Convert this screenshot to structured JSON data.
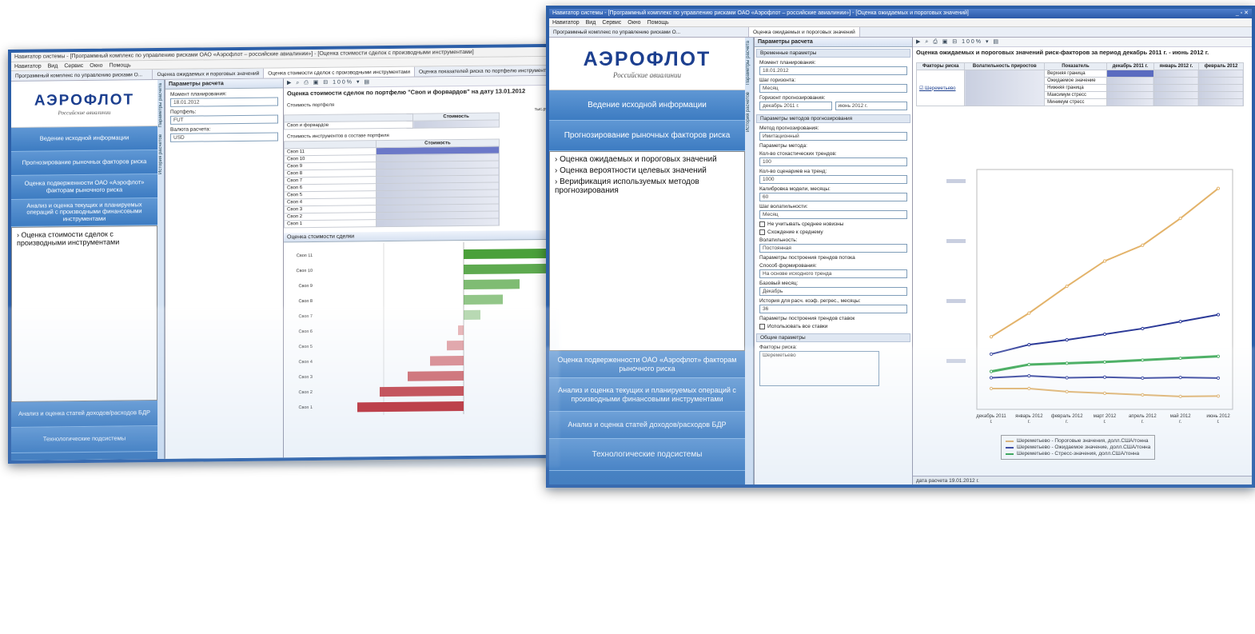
{
  "brand": {
    "logo": "АЭРОФЛОТ",
    "tagline": "Российские авиалинии",
    "colors": {
      "navy": "#1c3f8f",
      "nav_blue": "#4a86c8",
      "accent_red": "#d9272e",
      "frame": "#2c5fa8"
    }
  },
  "w1": {
    "title": "Навигатор системы - [Программный комплекс по управлению рисками ОАО «Аэрофлот – российские авиалинии»] - [Оценка стоимости сделок с производными инструментами]",
    "menu": [
      "Навигатор",
      "Вид",
      "Сервис",
      "Окно",
      "Помощь"
    ],
    "nav_header": "Программный комплекс по управлению рисками О...",
    "tabs": [
      "Оценка ожидаемых и пороговых значений",
      "Оценка стоимости сделок с производными инструментами",
      "Оценка показателей риска по портфелю инструментов"
    ],
    "nav_buttons": [
      "Ведение исходной информации",
      "Прогнозирование рыночных факторов риска",
      "Оценка подверженности ОАО «Аэрофлот» факторам рыночного риска",
      "Анализ и оценка текущих и планируемых операций с производными финансовыми инструментами"
    ],
    "nav_bottom": [
      "Анализ и оценка статей доходов/расходов БДР",
      "Технологические подсистемы"
    ],
    "tree": [
      "Оценка стоимости сделок с производными инструментами"
    ],
    "params_title": "Параметры расчета",
    "params": [
      {
        "label": "Момент планирования:",
        "value": "18.01.2012"
      },
      {
        "label": "Портфель:",
        "value": "FUT"
      },
      {
        "label": "Валюта расчета:",
        "value": "USD"
      }
    ],
    "vtabs": [
      "Параметры расчета",
      "История расчетов"
    ],
    "toolbar_zoom": "100%",
    "report_title": "Оценка стоимости сделок по портфелю \"Своп и форвардов\" на дату 13.01.2012",
    "sec1": "Стоимость портфеля",
    "unit": "тыс.руб.",
    "col_value": "Стоимость",
    "row1": "Своп и форвардов",
    "sec2": "Стоимость инструментов в составе портфеля",
    "rows2": [
      "Своп 11",
      "Своп 10",
      "Своп 9",
      "Своп 8",
      "Своп 7",
      "Своп 6",
      "Своп 5",
      "Своп 4",
      "Своп 3",
      "Своп 2",
      "Своп 1"
    ],
    "chart_panel": "Оценка стоимости сделки",
    "chart_data": {
      "type": "bar",
      "categories": [
        "Своп 11",
        "Своп 10",
        "Своп 9",
        "Своп 8",
        "Своп 7",
        "Своп 6",
        "Своп 5",
        "Своп 4",
        "Своп 3",
        "Своп 2",
        "Своп 1"
      ],
      "values": [
        9,
        7.5,
        5,
        3.5,
        1.5,
        -0.5,
        -1.5,
        -3,
        -5,
        -7.5,
        -9.5
      ],
      "orientation": "horizontal",
      "colors": {
        "positive": "#4aa03a",
        "negative": "#c0272d"
      }
    }
  },
  "w2": {
    "title": "Навигатор системы - [Программный комплекс по управлению рисками ОАО «Аэрофлот – российские авиалинии»] - [Оценка ожидаемых и пороговых значений]",
    "menu": [
      "Навигатор",
      "Вид",
      "Сервис",
      "Окно",
      "Помощь"
    ],
    "nav_header": "Программный комплекс по управлению рисками О...",
    "tab": "Оценка ожидаемых и пороговых значений",
    "nav_buttons": [
      "Ведение исходной информации",
      "Прогнозирование рыночных факторов риска"
    ],
    "tree": [
      "Оценка ожидаемых и пороговых значений",
      "Оценка вероятности целевых значений",
      "Верификация используемых методов прогнозирования"
    ],
    "nav_bottom": [
      "Оценка подверженности ОАО «Аэрофлот» факторам рыночного риска",
      "Анализ и оценка текущих и планируемых операций с производными финансовыми инструментами",
      "Анализ и оценка статей доходов/расходов БДР",
      "Технологические подсистемы"
    ],
    "params_title": "Параметры расчета",
    "vtabs": [
      "Параметры расчета",
      "История расчетов"
    ],
    "sec_time": "Временные параметры",
    "f_moment": "Момент планирования:",
    "v_moment": "18.01.2012",
    "f_step": "Шаг горизонта:",
    "v_step": "Месяц",
    "f_horizon": "Горизонт прогнозирования:",
    "v_h_from": "декабрь 2011 г.",
    "v_h_to": "июнь 2012 г.",
    "sec_method": "Параметры методов прогнозирования",
    "f_method": "Метод прогнозирования:",
    "v_method": "Имитационный",
    "f_mparams": "Параметры метода:",
    "f_ntrends": "Кол-во стохастических трендов:",
    "v_ntrends": "100",
    "f_nscen": "Кол-во сценариев на тренд:",
    "v_nscen": "1000",
    "f_calib": "Калибровка модели, месяцы:",
    "v_calib": "60",
    "f_volstep": "Шаг волатильности:",
    "v_volstep": "Месяц",
    "chk1": "Не учитывать среднее новизны",
    "chk2": "Схождение к среднему",
    "f_vol": "Волатильность:",
    "v_vol": "Постоянная",
    "f_trend": "Параметры построения трендов потока",
    "f_trendway": "Способ формирования:",
    "v_trendway": "На основе исходного тренда",
    "f_basemonth": "Базовый месяц:",
    "v_basemonth": "Декабрь",
    "f_hist": "История для расч. коэф. регрес., месяцы:",
    "v_hist": "36",
    "f_rates": "Параметры построения трендов ставок",
    "chk3": "Использовать все ставки",
    "sec_common": "Общие параметры",
    "f_factors": "Факторы риска:",
    "v_factors": "Шереметьево",
    "toolbar_zoom": "100%",
    "report_title": "Оценка ожидаемых и пороговых значений риск-факторов за период декабрь 2011 г. - июнь 2012 г.",
    "table_headers": [
      "Факторы риска",
      "Волатильность приростов",
      "Показатель",
      "декабрь 2011 г.",
      "январь 2012 г.",
      "февраль 2012"
    ],
    "table_factor": "Шереметьево",
    "table_rows": [
      "Верхняя граница",
      "Ожидаемое значение",
      "Нижняя граница",
      "Максимум стресс",
      "Минимум стресс"
    ],
    "x_ticks": [
      "декабрь 2011 г.",
      "январь 2012 г.",
      "февраль 2012 г.",
      "март 2012 г.",
      "апрель 2012 г.",
      "май 2012 г.",
      "июнь 2012 г."
    ],
    "legend": [
      "Шереметьево - Пороговые значения, долл.США/тонна",
      "Шереметьево - Ожидаемое значение, долл.США/тонна",
      "Шереметьево - Стресс-значения, долл.США/тонна"
    ],
    "status": "дата расчета 19.01.2012 г.",
    "chart_data": {
      "type": "line",
      "x": [
        "декабрь 2011 г.",
        "январь 2012 г.",
        "февраль 2012 г.",
        "март 2012 г.",
        "апрель 2012 г.",
        "май 2012 г.",
        "июнь 2012 г."
      ],
      "series": [
        {
          "values": [
            1010,
            1085,
            1170,
            1250,
            1300,
            1385,
            1480
          ],
          "color": "#e3b36a"
        },
        {
          "values": [
            955,
            985,
            1000,
            1018,
            1036,
            1058,
            1080
          ],
          "color": "#2c3a98"
        },
        {
          "values": [
            900,
            922,
            926,
            930,
            936,
            942,
            948
          ],
          "color": "#2fa34a"
        },
        {
          "values": [
            880,
            886,
            880,
            882,
            879,
            881,
            879
          ],
          "color": "#2c3a98"
        },
        {
          "values": [
            846,
            846,
            836,
            831,
            826,
            821,
            822
          ],
          "color": "#e3b36a"
        }
      ],
      "ylim": [
        780,
        1540
      ],
      "grid": false
    }
  }
}
